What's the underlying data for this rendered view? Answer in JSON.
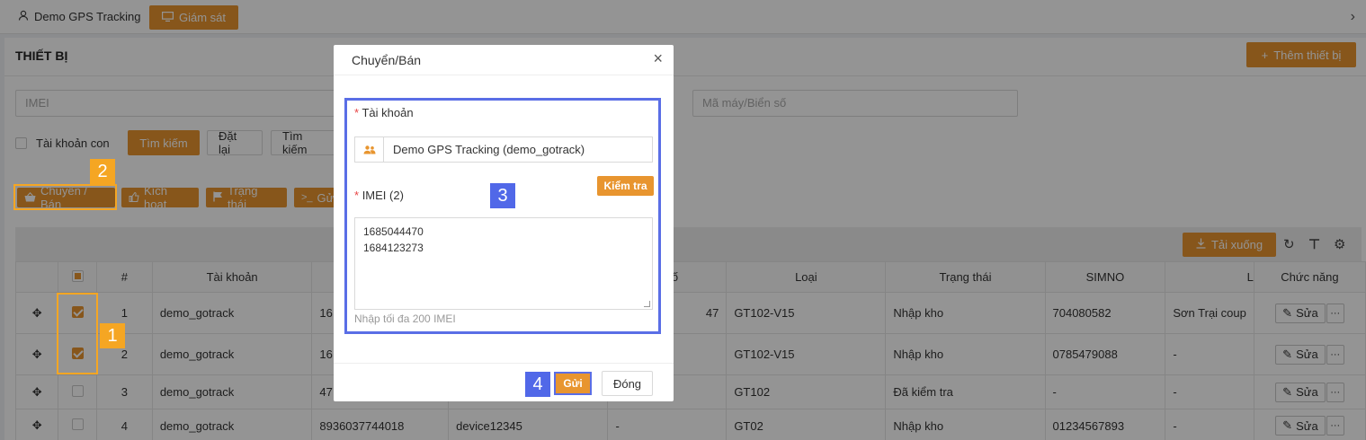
{
  "topbar": {
    "user": "Demo GPS Tracking",
    "monitor": "Giám sát"
  },
  "page": {
    "title": "THIẾT BỊ",
    "add_device": "Thêm thiết bị"
  },
  "filters": {
    "imei_placeholder": "IMEI",
    "plate_placeholder": "Mã máy/Biển số",
    "sub_account": "Tài khoản con",
    "search": "Tìm kiếm",
    "reset": "Đặt lại",
    "search_more": "Tìm kiếm"
  },
  "actions": {
    "transfer": "Chuyển / Bán",
    "activate": "Kích hoạt",
    "status": "Trạng thái",
    "send": "Gử"
  },
  "table_toolbar": {
    "download": "Tải xuống"
  },
  "table": {
    "headers": {
      "index": "#",
      "account": "Tài khoản",
      "plate": "n số",
      "type": "Loại",
      "status": "Trạng thái",
      "simno": "SIMNO",
      "l": "L",
      "functions": "Chức năng"
    },
    "edit_label": "Sửa",
    "rows": [
      {
        "index": "1",
        "account": "demo_gotrack",
        "imei": "16",
        "name": "",
        "plate": "47",
        "type": "GT102-V15",
        "status": "Nhập kho",
        "simno": "704080582",
        "l": "Sơn Trại coup",
        "checked": true
      },
      {
        "index": "2",
        "account": "demo_gotrack",
        "imei": "16",
        "name": "",
        "plate": "",
        "type": "GT102-V15",
        "status": "Nhập kho",
        "simno": "0785479088",
        "l": "-",
        "checked": true
      },
      {
        "index": "3",
        "account": "demo_gotrack",
        "imei": "47",
        "name": "",
        "plate": "",
        "type": "GT102",
        "status": "Đã kiểm tra",
        "simno": "-",
        "l": "-",
        "checked": false
      },
      {
        "index": "4",
        "account": "demo_gotrack",
        "imei": "8936037744018",
        "name": "device12345",
        "plate": "-",
        "type": "GT02",
        "status": "Nhập kho",
        "simno": "01234567893",
        "l": "-",
        "checked": false
      }
    ]
  },
  "modal": {
    "title": "Chuyển/Bán",
    "account_label": "Tài khoản",
    "account_value": "Demo GPS Tracking (demo_gotrack)",
    "check": "Kiểm tra",
    "imei_label": "IMEI (2)",
    "imei_lines": [
      "1685044470",
      "1684123273"
    ],
    "hint": "Nhập tối đa 200 IMEI",
    "send": "Gửi",
    "close": "Đóng"
  },
  "annotations": {
    "n1": "1",
    "n2": "2",
    "n3": "3",
    "n4": "4"
  }
}
